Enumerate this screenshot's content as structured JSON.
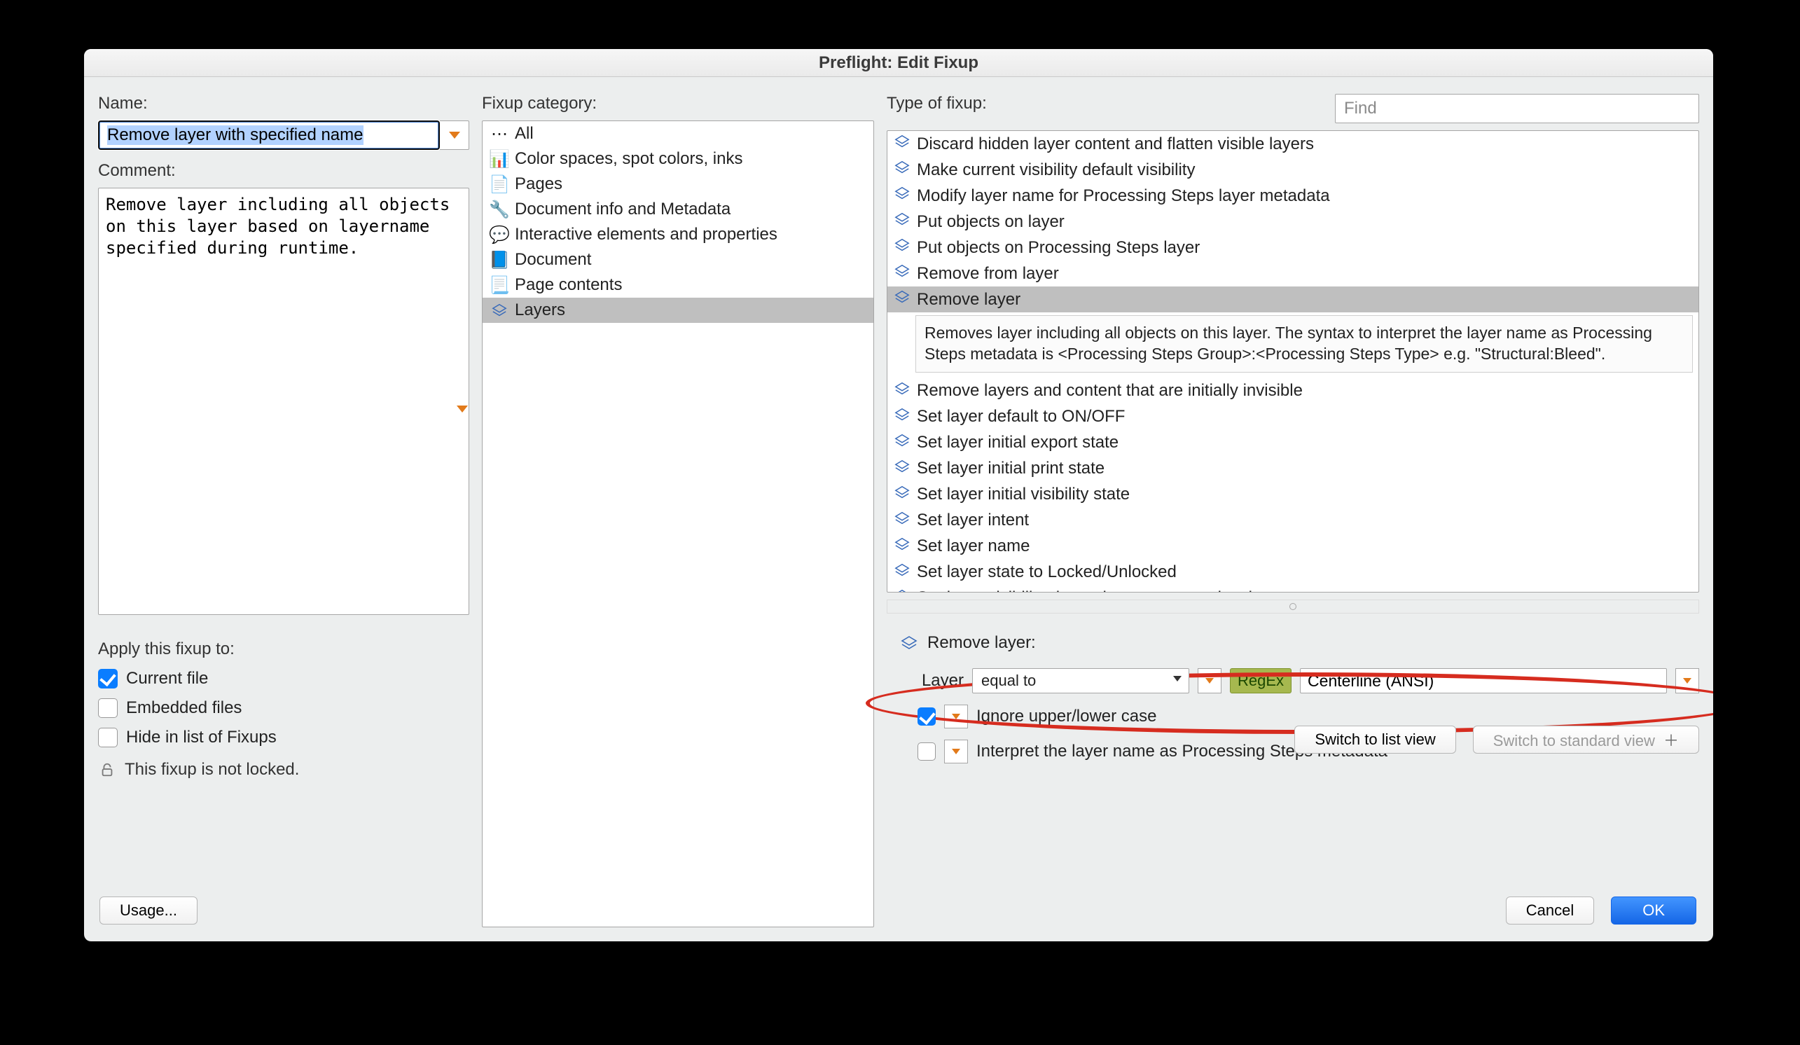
{
  "title": "Preflight: Edit Fixup",
  "left": {
    "name_label": "Name:",
    "name_value": "Remove layer with specified name",
    "comment_label": "Comment:",
    "comment_value": "Remove layer including all objects on this layer based on layername specified during runtime.",
    "apply_label": "Apply this fixup to:",
    "chk_current": "Current file",
    "chk_embedded": "Embedded files",
    "chk_hide": "Hide in list of Fixups",
    "lock_text": "This fixup is not locked."
  },
  "mid": {
    "label": "Fixup category:",
    "items": [
      "All",
      "Color spaces, spot colors, inks",
      "Pages",
      "Document info and Metadata",
      "Interactive elements and properties",
      "Document",
      "Page contents",
      "Layers"
    ],
    "selected_index": 7
  },
  "right": {
    "label": "Type of fixup:",
    "find_placeholder": "Find",
    "items": [
      "Discard hidden layer content and flatten visible layers",
      "Make current visibility default visibility",
      "Modify layer name for Processing Steps layer metadata",
      "Put objects on layer",
      "Put objects on Processing Steps layer",
      "Remove from layer",
      "Remove layer",
      "Remove layers and content that are initially invisible",
      "Set layer default to ON/OFF",
      "Set layer initial export state",
      "Set layer initial print state",
      "Set layer initial visibility state",
      "Set layer intent",
      "Set layer name",
      "Set layer state to Locked/Unlocked",
      "Set layer visibility dependent on a zoom level"
    ],
    "selected_index": 6,
    "selected_desc": "Removes layer including all objects on this layer. The syntax to interpret the layer name as Processing Steps metadata is <Processing Steps Group>:<Processing Steps Type> e.g. \"Structural:Bleed\"."
  },
  "lower": {
    "title": "Remove layer:",
    "layer_label": "Layer",
    "operator": "equal to",
    "regex_label": "RegEx",
    "value": "Centerline (ANSI)",
    "opt_ignore_case": "Ignore upper/lower case",
    "opt_interpret_ps": "Interpret the layer name as Processing Steps metadata",
    "btn_list_view": "Switch to list view",
    "btn_std_view": "Switch to standard view"
  },
  "footer": {
    "usage": "Usage...",
    "cancel": "Cancel",
    "ok": "OK"
  }
}
